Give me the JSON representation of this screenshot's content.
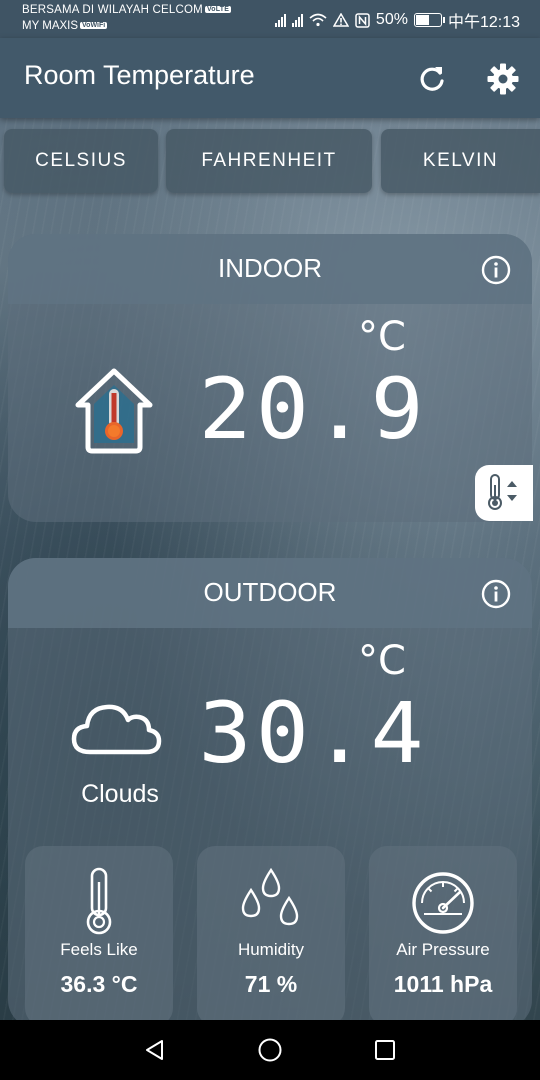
{
  "status_bar": {
    "carrier_line1": "BERSAMA DI WILAYAH CELCOM",
    "carrier_line1_tag": "VoLTE",
    "carrier_line2": "MY MAXIS",
    "carrier_line2_tag": "VoWiFi",
    "battery_percent": "50%",
    "time": "中午12:13"
  },
  "app_bar": {
    "title": "Room Temperature"
  },
  "unit_tabs": [
    {
      "label": "CELSIUS"
    },
    {
      "label": "FAHRENHEIT"
    },
    {
      "label": "KELVIN"
    }
  ],
  "indoor": {
    "title": "INDOOR",
    "temperature": "20.9",
    "unit": "°C"
  },
  "outdoor": {
    "title": "OUTDOOR",
    "temperature": "30.4",
    "unit": "°C",
    "condition": "Clouds"
  },
  "stats": [
    {
      "label": "Feels Like",
      "value": "36.3 °C",
      "icon": "thermometer-icon"
    },
    {
      "label": "Humidity",
      "value": "71 %",
      "icon": "water-drops-icon"
    },
    {
      "label": "Air Pressure",
      "value": "1011 hPa",
      "icon": "gauge-icon"
    }
  ],
  "colors": {
    "app_bar": "#42596a",
    "house_thermo_red": "#c0392b",
    "house_thermo_orange": "#e8652a"
  }
}
